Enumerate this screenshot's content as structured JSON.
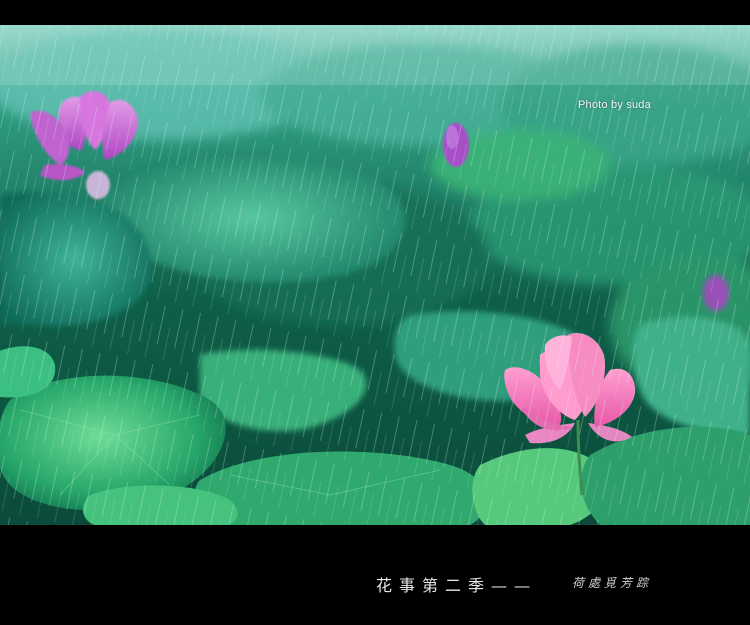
{
  "photo": {
    "credit": "Photo by suda",
    "subject": "lotus-pond-in-rain"
  },
  "caption": {
    "title": "花事第二季——",
    "subtitle": "荷處覓芳踪"
  },
  "colors": {
    "frame": "#000000",
    "leaf_dark": "#0e6f4f",
    "leaf_light": "#4fc08a",
    "lotus_pink": "#f06fb0",
    "bud_purple": "#a04fc0"
  }
}
